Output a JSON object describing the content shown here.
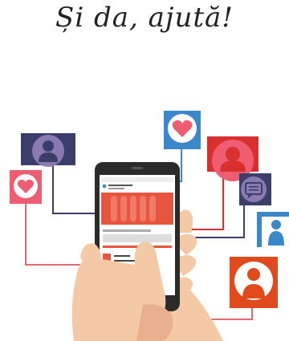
{
  "headline": "Și da, ajută!",
  "colors": {
    "hand": "#f4c9a5",
    "hand_shadow": "#e8b08c",
    "phone": "#2b2b2b",
    "screen_banner": "#e8553f",
    "pink": "#ee5d72",
    "blue": "#3a87c9",
    "navy": "#3c3e6a",
    "purple": "#8a7ab2",
    "red": "#d92f2f",
    "orange": "#e04a1c",
    "line_pink": "#e06a78",
    "line_navy": "#3c3e6a"
  },
  "icons": [
    "heart-icon",
    "user-icon",
    "chat-icon",
    "user-icon",
    "user-icon",
    "heart-icon",
    "user-icon"
  ]
}
